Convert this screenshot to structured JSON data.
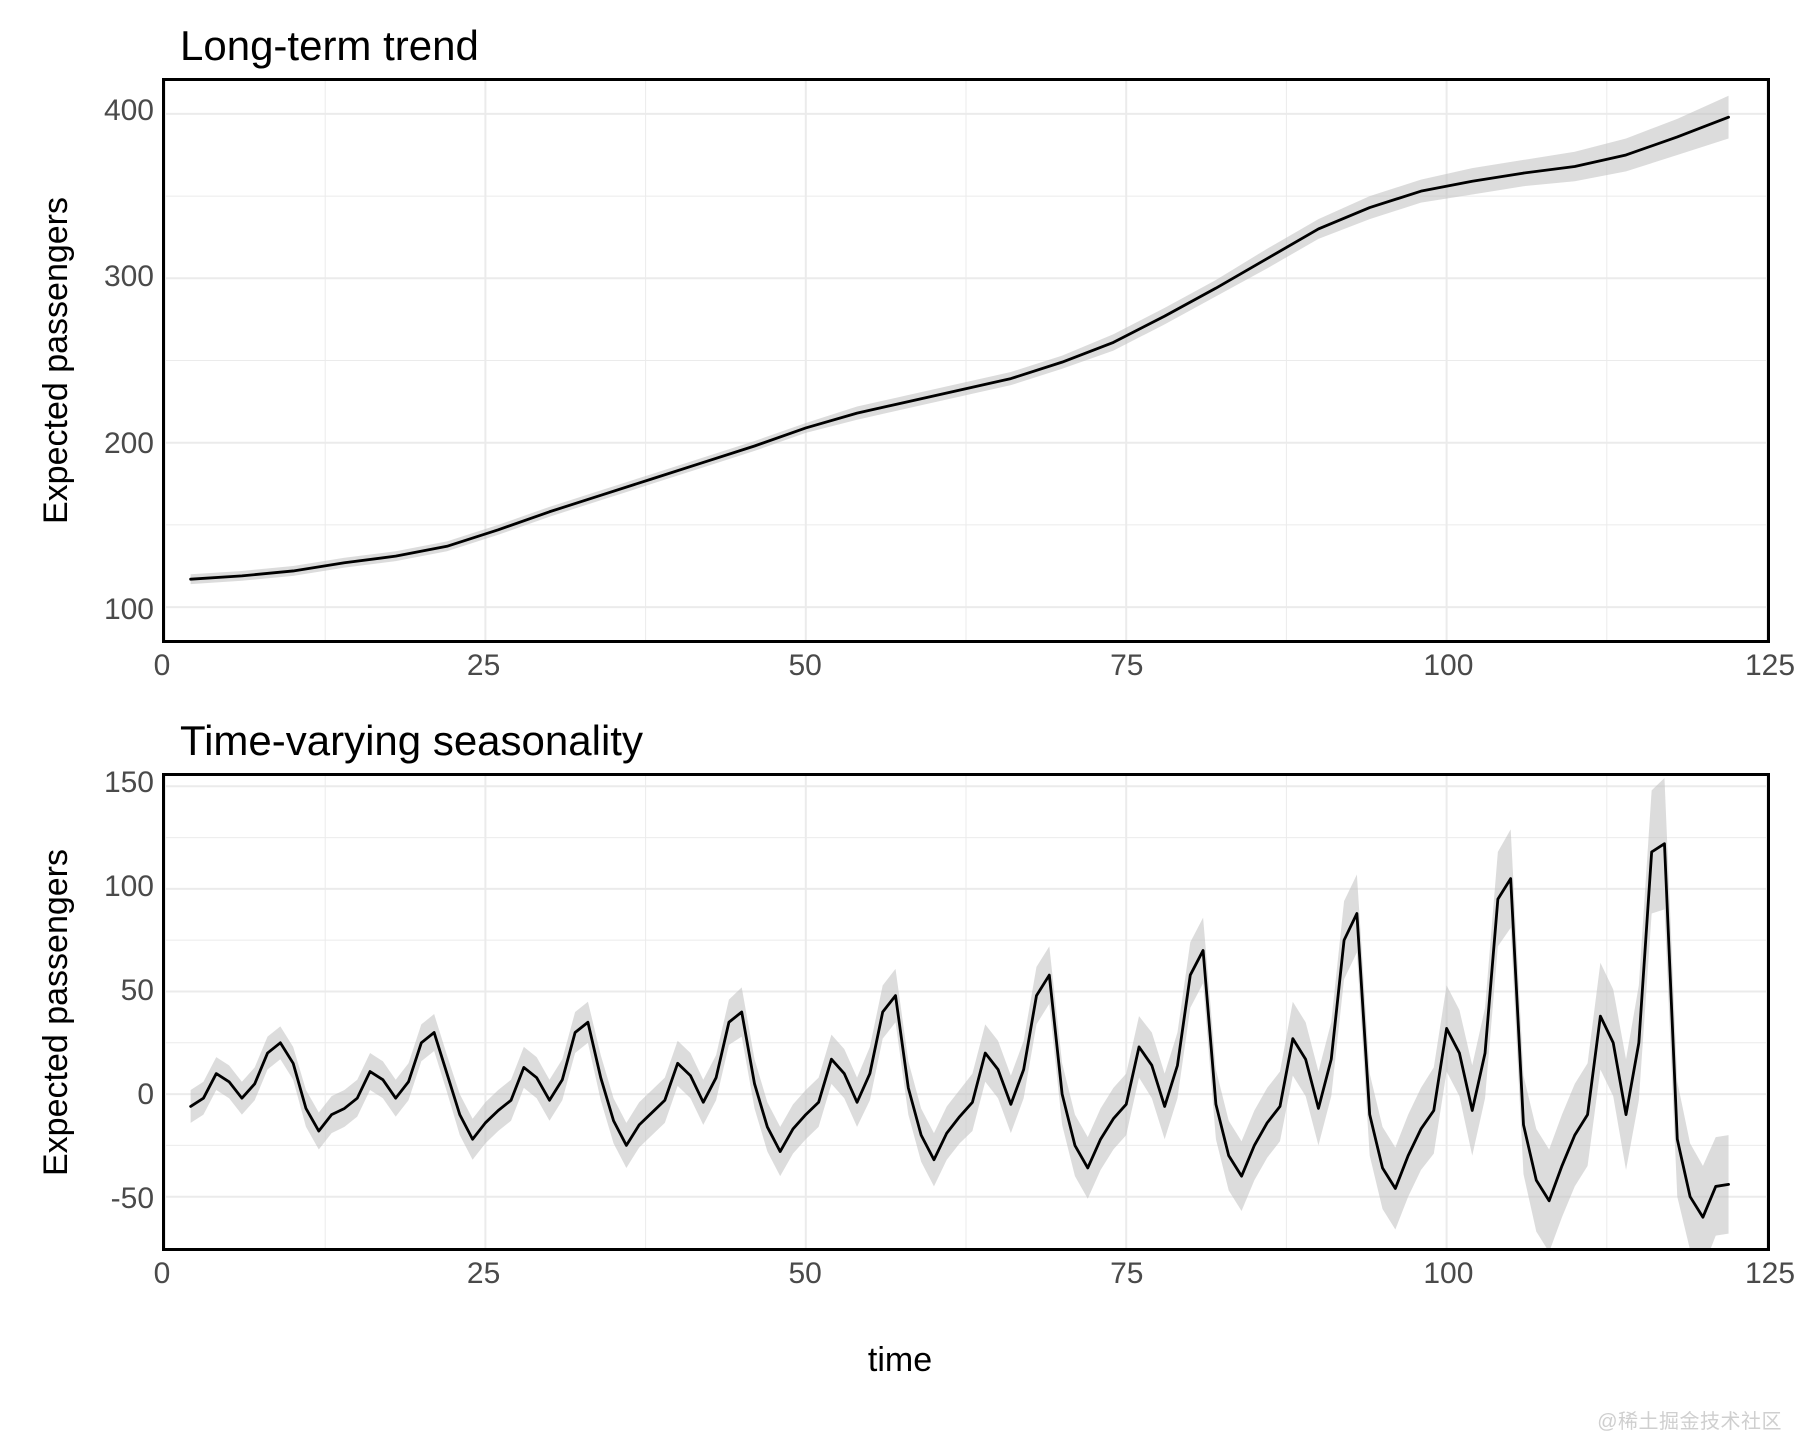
{
  "watermark": "@稀土掘金技术社区",
  "chart_data": [
    {
      "id": "trend",
      "type": "line",
      "title": "Long-term trend",
      "xlabel": "",
      "ylabel": "Expected passengers",
      "xlim": [
        0,
        125
      ],
      "ylim": [
        80,
        420
      ],
      "xticks": [
        0,
        25,
        50,
        75,
        100,
        125
      ],
      "yticks": [
        100,
        200,
        300,
        400
      ],
      "xminor": [
        12.5,
        37.5,
        62.5,
        87.5,
        112.5
      ],
      "yminor": [
        150,
        250,
        350
      ],
      "x": [
        2,
        6,
        10,
        14,
        18,
        22,
        26,
        30,
        34,
        38,
        42,
        46,
        50,
        54,
        58,
        62,
        66,
        70,
        74,
        78,
        82,
        86,
        90,
        94,
        98,
        102,
        106,
        110,
        114,
        118,
        122
      ],
      "series": [
        {
          "name": "trend",
          "values": [
            117,
            119,
            122,
            127,
            131,
            137,
            147,
            158,
            168,
            178,
            188,
            198,
            209,
            218,
            225,
            232,
            239,
            249,
            261,
            277,
            294,
            312,
            330,
            343,
            353,
            359,
            364,
            368,
            375,
            386,
            398
          ]
        }
      ],
      "ribbon_halfwidth": [
        3,
        3,
        3,
        3,
        3,
        3,
        3,
        3,
        3,
        3,
        3,
        3,
        3,
        4,
        4,
        4,
        4,
        4,
        5,
        5,
        5,
        6,
        6,
        7,
        7,
        8,
        8,
        9,
        10,
        11,
        13
      ]
    },
    {
      "id": "season",
      "type": "line",
      "title": "Time-varying seasonality",
      "xlabel": "time",
      "ylabel": "Expected passengers",
      "xlim": [
        0,
        125
      ],
      "ylim": [
        -75,
        155
      ],
      "xticks": [
        0,
        25,
        50,
        75,
        100,
        125
      ],
      "yticks": [
        -50,
        0,
        50,
        100,
        150
      ],
      "xminor": [
        12.5,
        37.5,
        62.5,
        87.5,
        112.5
      ],
      "yminor": [
        -25,
        25,
        75,
        125
      ],
      "x": [
        2,
        3,
        4,
        5,
        6,
        7,
        8,
        9,
        10,
        11,
        12,
        13,
        14,
        15,
        16,
        17,
        18,
        19,
        20,
        21,
        22,
        23,
        24,
        25,
        26,
        27,
        28,
        29,
        30,
        31,
        32,
        33,
        34,
        35,
        36,
        37,
        38,
        39,
        40,
        41,
        42,
        43,
        44,
        45,
        46,
        47,
        48,
        49,
        50,
        51,
        52,
        53,
        54,
        55,
        56,
        57,
        58,
        59,
        60,
        61,
        62,
        63,
        64,
        65,
        66,
        67,
        68,
        69,
        70,
        71,
        72,
        73,
        74,
        75,
        76,
        77,
        78,
        79,
        80,
        81,
        82,
        83,
        84,
        85,
        86,
        87,
        88,
        89,
        90,
        91,
        92,
        93,
        94,
        95,
        96,
        97,
        98,
        99,
        100,
        101,
        102,
        103,
        104,
        105,
        106,
        107,
        108,
        109,
        110,
        111,
        112,
        113,
        114,
        115,
        116,
        117,
        118,
        119,
        120,
        121,
        122
      ],
      "series": [
        {
          "name": "seasonality",
          "values": [
            -6,
            -2,
            10,
            6,
            -2,
            5,
            20,
            25,
            15,
            -7,
            -18,
            -10,
            -7,
            -2,
            11,
            7,
            -2,
            6,
            25,
            30,
            10,
            -10,
            -22,
            -14,
            -8,
            -3,
            13,
            8,
            -3,
            7,
            30,
            35,
            8,
            -13,
            -25,
            -15,
            -9,
            -3,
            15,
            9,
            -4,
            8,
            35,
            40,
            5,
            -16,
            -28,
            -17,
            -10,
            -4,
            17,
            10,
            -4,
            10,
            40,
            48,
            3,
            -20,
            -32,
            -19,
            -11,
            -4,
            20,
            12,
            -5,
            12,
            48,
            58,
            0,
            -25,
            -36,
            -22,
            -12,
            -5,
            23,
            14,
            -6,
            14,
            58,
            70,
            -5,
            -30,
            -40,
            -25,
            -14,
            -6,
            27,
            17,
            -7,
            17,
            75,
            88,
            -10,
            -36,
            -46,
            -30,
            -17,
            -8,
            32,
            20,
            -8,
            20,
            95,
            105,
            -15,
            -42,
            -52,
            -35,
            -20,
            -10,
            38,
            25,
            -10,
            25,
            118,
            122,
            -22,
            -50,
            -60,
            -45,
            -44,
            -44
          ]
        }
      ],
      "ribbon_halfwidth": [
        8,
        8,
        8,
        8,
        8,
        8,
        8,
        8,
        8,
        9,
        9,
        9,
        9,
        9,
        9,
        9,
        9,
        9,
        9,
        9,
        9,
        10,
        10,
        10,
        10,
        10,
        10,
        10,
        10,
        10,
        10,
        10,
        11,
        11,
        11,
        11,
        11,
        11,
        11,
        11,
        11,
        11,
        11,
        12,
        12,
        12,
        12,
        12,
        12,
        12,
        12,
        12,
        12,
        13,
        13,
        13,
        13,
        13,
        13,
        13,
        13,
        14,
        14,
        14,
        14,
        14,
        14,
        14,
        15,
        15,
        15,
        15,
        15,
        15,
        15,
        16,
        16,
        16,
        16,
        16,
        17,
        17,
        17,
        17,
        17,
        17,
        18,
        18,
        18,
        18,
        19,
        19,
        20,
        20,
        20,
        20,
        20,
        21,
        21,
        21,
        22,
        22,
        23,
        24,
        24,
        25,
        25,
        25,
        25,
        25,
        26,
        26,
        27,
        28,
        30,
        32,
        28,
        26,
        25,
        24,
        24
      ]
    }
  ]
}
